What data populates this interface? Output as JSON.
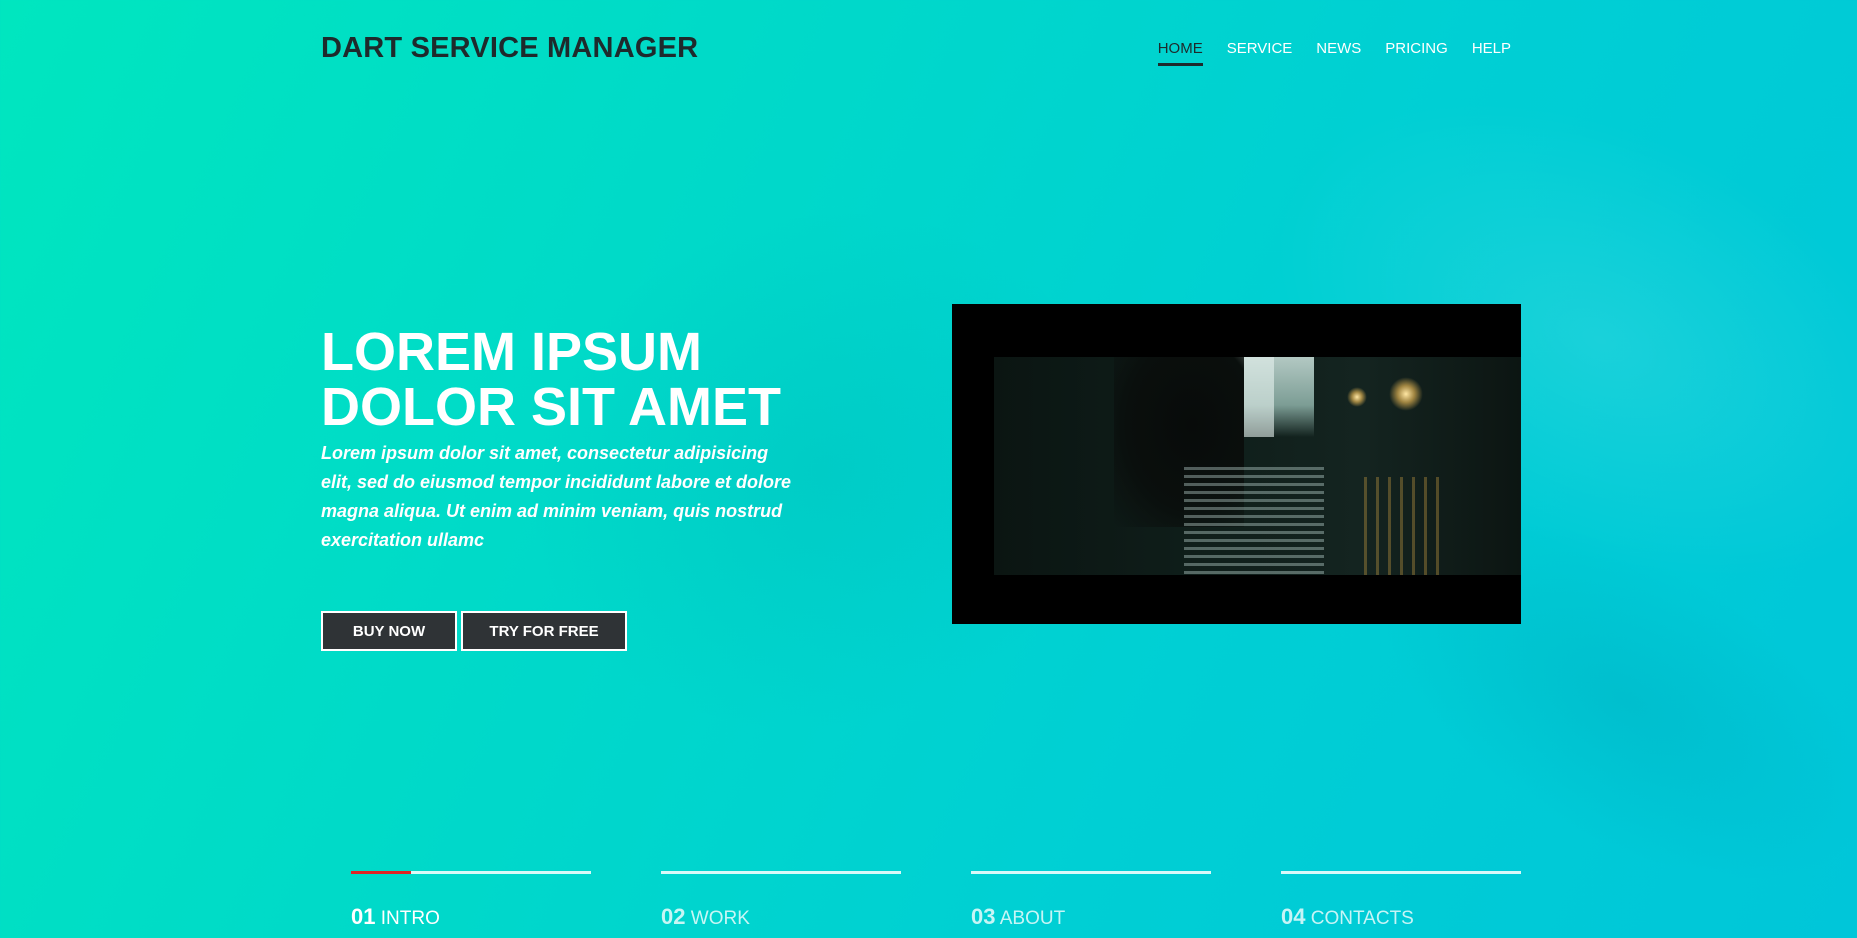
{
  "header": {
    "brand": "DART SERVICE MANAGER",
    "nav": [
      {
        "label": "HOME",
        "active": true
      },
      {
        "label": "SERVICE",
        "active": false
      },
      {
        "label": "NEWS",
        "active": false
      },
      {
        "label": "PRICING",
        "active": false
      },
      {
        "label": "HELP",
        "active": false
      }
    ]
  },
  "hero": {
    "title_line1": "LOREM IPSUM",
    "title_line2": "DOLOR SIT AMET",
    "text": "Lorem ipsum dolor sit amet, consectetur adipisicing elit, sed do eiusmod tempor incididunt labore et dolore magna aliqua. Ut enim ad minim veniam, quis nostrud exercitation ullamc",
    "buy_label": "BUY NOW",
    "try_label": "TRY FOR FREE"
  },
  "sections": [
    {
      "num": "01",
      "label": "INTRO",
      "progress": 0.25
    },
    {
      "num": "02",
      "label": "WORK",
      "progress": 0
    },
    {
      "num": "03",
      "label": "ABOUT",
      "progress": 0
    },
    {
      "num": "04",
      "label": "CONTACTS",
      "progress": 0
    }
  ],
  "colors": {
    "accent_progress": "#e02424",
    "button_bg": "#2f3336",
    "brand_text": "#1e2a2c"
  }
}
